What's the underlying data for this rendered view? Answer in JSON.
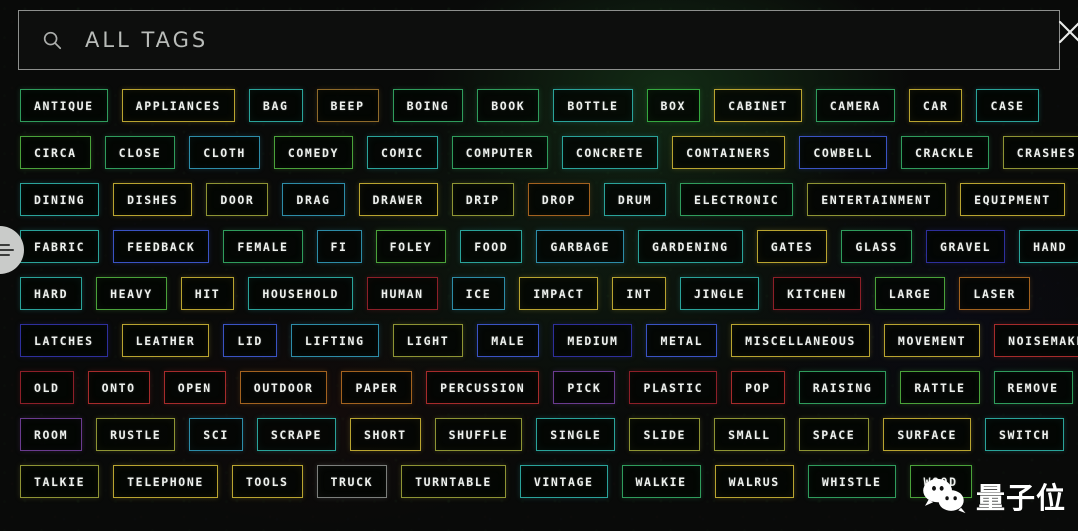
{
  "search": {
    "placeholder": "ALL TAGS",
    "value": "",
    "icon": "search-icon",
    "close_icon": "close-icon",
    "close_label": "✕"
  },
  "handle": {
    "icon": "drag-handle-icon"
  },
  "watermark": {
    "text": "量子位",
    "icon": "wechat-icon"
  },
  "palette": {
    "green": "#2f9c5c",
    "teal": "#2aa39a",
    "yellow": "#b9a430",
    "olive": "#8e9434",
    "blue": "#3a53c4",
    "indigo": "#2e2f9c",
    "red": "#a62b2b",
    "crimson": "#8d1f28",
    "orange": "#a3621f",
    "purple": "#6a3b8f",
    "cyan": "#2d8ca8",
    "gray": "#7c7f7c"
  },
  "rows": [
    [
      {
        "label": "ANTIQUE",
        "color": "#2f9c5c"
      },
      {
        "label": "APPLIANCES",
        "color": "#b9a430"
      },
      {
        "label": "BAG",
        "color": "#2aa39a"
      },
      {
        "label": "BEEP",
        "color": "#8e6a2a"
      },
      {
        "label": "BOING",
        "color": "#2f9c5c"
      },
      {
        "label": "BOOK",
        "color": "#2f9c5c"
      },
      {
        "label": "BOTTLE",
        "color": "#2aa39a"
      },
      {
        "label": "BOX",
        "color": "#35a83f"
      },
      {
        "label": "CABINET",
        "color": "#b9a430"
      },
      {
        "label": "CAMERA",
        "color": "#2f9c5c"
      },
      {
        "label": "CAR",
        "color": "#b9a430"
      },
      {
        "label": "CASE",
        "color": "#2aa39a"
      }
    ],
    [
      {
        "label": "CIRCA",
        "color": "#4aa23a"
      },
      {
        "label": "CLOSE",
        "color": "#2f9c5c"
      },
      {
        "label": "CLOTH",
        "color": "#2d8ca8"
      },
      {
        "label": "COMEDY",
        "color": "#4aa23a"
      },
      {
        "label": "COMIC",
        "color": "#2aa39a"
      },
      {
        "label": "COMPUTER",
        "color": "#2f9c5c"
      },
      {
        "label": "CONCRETE",
        "color": "#2aa39a"
      },
      {
        "label": "CONTAINERS",
        "color": "#b9a430"
      },
      {
        "label": "COWBELL",
        "color": "#3a53c4"
      },
      {
        "label": "CRACKLE",
        "color": "#2f9c5c"
      },
      {
        "label": "CRASHES",
        "color": "#8e9434"
      }
    ],
    [
      {
        "label": "DINING",
        "color": "#2aa39a"
      },
      {
        "label": "DISHES",
        "color": "#b9a430"
      },
      {
        "label": "DOOR",
        "color": "#8e9434"
      },
      {
        "label": "DRAG",
        "color": "#2d8ca8"
      },
      {
        "label": "DRAWER",
        "color": "#b9a430"
      },
      {
        "label": "DRIP",
        "color": "#8e9434"
      },
      {
        "label": "DROP",
        "color": "#a3621f"
      },
      {
        "label": "DRUM",
        "color": "#2aa39a"
      },
      {
        "label": "ELECTRONIC",
        "color": "#2f9c5c"
      },
      {
        "label": "ENTERTAINMENT",
        "color": "#8e9434"
      },
      {
        "label": "EQUIPMENT",
        "color": "#b9a430"
      }
    ],
    [
      {
        "label": "FABRIC",
        "color": "#2aa39a"
      },
      {
        "label": "FEEDBACK",
        "color": "#3a53c4"
      },
      {
        "label": "FEMALE",
        "color": "#2f9c5c"
      },
      {
        "label": "FI",
        "color": "#2d8ca8"
      },
      {
        "label": "FOLEY",
        "color": "#4aa23a"
      },
      {
        "label": "FOOD",
        "color": "#2aa39a"
      },
      {
        "label": "GARBAGE",
        "color": "#2d8ca8"
      },
      {
        "label": "GARDENING",
        "color": "#2aa39a"
      },
      {
        "label": "GATES",
        "color": "#b9a430"
      },
      {
        "label": "GLASS",
        "color": "#2f9c5c"
      },
      {
        "label": "GRAVEL",
        "color": "#2e2f9c"
      },
      {
        "label": "HAND",
        "color": "#2aa39a"
      }
    ],
    [
      {
        "label": "HARD",
        "color": "#2aa39a"
      },
      {
        "label": "HEAVY",
        "color": "#4aa23a"
      },
      {
        "label": "HIT",
        "color": "#b9a430"
      },
      {
        "label": "HOUSEHOLD",
        "color": "#2aa39a"
      },
      {
        "label": "HUMAN",
        "color": "#8d1f28"
      },
      {
        "label": "ICE",
        "color": "#2d8ca8"
      },
      {
        "label": "IMPACT",
        "color": "#b9a430"
      },
      {
        "label": "INT",
        "color": "#b9a430"
      },
      {
        "label": "JINGLE",
        "color": "#2aa39a"
      },
      {
        "label": "KITCHEN",
        "color": "#8d1f28"
      },
      {
        "label": "LARGE",
        "color": "#4aa23a"
      },
      {
        "label": "LASER",
        "color": "#a3621f"
      }
    ],
    [
      {
        "label": "LATCHES",
        "color": "#2e2f9c"
      },
      {
        "label": "LEATHER",
        "color": "#b9a430"
      },
      {
        "label": "LID",
        "color": "#3a53c4"
      },
      {
        "label": "LIFTING",
        "color": "#2d8ca8"
      },
      {
        "label": "LIGHT",
        "color": "#8e9434"
      },
      {
        "label": "MALE",
        "color": "#3a53c4"
      },
      {
        "label": "MEDIUM",
        "color": "#2e2f9c"
      },
      {
        "label": "METAL",
        "color": "#3a53c4"
      },
      {
        "label": "MISCELLANEOUS",
        "color": "#b9a430"
      },
      {
        "label": "MOVEMENT",
        "color": "#b9a430"
      },
      {
        "label": "NOISEMAKERS",
        "color": "#a62b2b"
      }
    ],
    [
      {
        "label": "OLD",
        "color": "#8d1f28"
      },
      {
        "label": "ONTO",
        "color": "#a62b2b"
      },
      {
        "label": "OPEN",
        "color": "#a62b2b"
      },
      {
        "label": "OUTDOOR",
        "color": "#a3621f"
      },
      {
        "label": "PAPER",
        "color": "#a3621f"
      },
      {
        "label": "PERCUSSION",
        "color": "#a62b2b"
      },
      {
        "label": "PICK",
        "color": "#6a3b8f"
      },
      {
        "label": "PLASTIC",
        "color": "#8d1f28"
      },
      {
        "label": "POP",
        "color": "#a62b2b"
      },
      {
        "label": "RAISING",
        "color": "#2f9c5c"
      },
      {
        "label": "RATTLE",
        "color": "#4aa23a"
      },
      {
        "label": "REMOVE",
        "color": "#2f9c5c"
      }
    ],
    [
      {
        "label": "ROOM",
        "color": "#6a3b8f"
      },
      {
        "label": "RUSTLE",
        "color": "#8e9434"
      },
      {
        "label": "SCI",
        "color": "#2d8ca8"
      },
      {
        "label": "SCRAPE",
        "color": "#2aa39a"
      },
      {
        "label": "SHORT",
        "color": "#b9a430"
      },
      {
        "label": "SHUFFLE",
        "color": "#8e9434"
      },
      {
        "label": "SINGLE",
        "color": "#2aa39a"
      },
      {
        "label": "SLIDE",
        "color": "#8e9434"
      },
      {
        "label": "SMALL",
        "color": "#8e9434"
      },
      {
        "label": "SPACE",
        "color": "#8e9434"
      },
      {
        "label": "SURFACE",
        "color": "#b9a430"
      },
      {
        "label": "SWITCH",
        "color": "#2aa39a"
      }
    ],
    [
      {
        "label": "TALKIE",
        "color": "#8e9434"
      },
      {
        "label": "TELEPHONE",
        "color": "#b9a430"
      },
      {
        "label": "TOOLS",
        "color": "#b9a430"
      },
      {
        "label": "TRUCK",
        "color": "#7c7f7c"
      },
      {
        "label": "TURNTABLE",
        "color": "#8e9434"
      },
      {
        "label": "VINTAGE",
        "color": "#2aa39a"
      },
      {
        "label": "WALKIE",
        "color": "#2f9c5c"
      },
      {
        "label": "WALRUS",
        "color": "#b9a430"
      },
      {
        "label": "WHISTLE",
        "color": "#2f9c5c"
      },
      {
        "label": "WOOD",
        "color": "#4aa23a"
      }
    ]
  ]
}
